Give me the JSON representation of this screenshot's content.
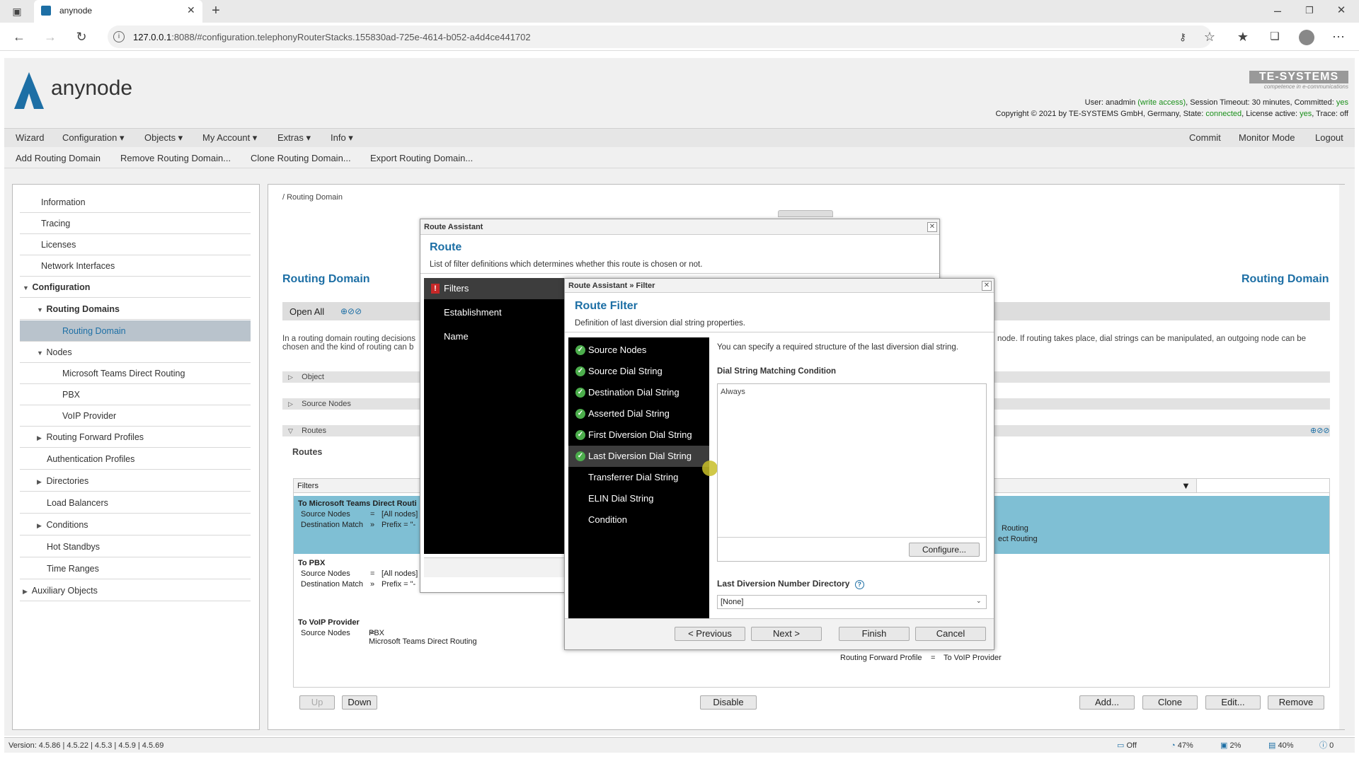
{
  "browser": {
    "tab_title": "anynode",
    "url_host": "127.0.0.1",
    "url_rest": ":8088/#configuration.telephonyRouterStacks.155830ad-725e-4614-b052-a4d4ce441702"
  },
  "header": {
    "logo_text": "anynode",
    "brand": "TE-SYSTEMS",
    "brand_tagline": "competence in e-communications",
    "status_line1_pre": "User: anadmin ",
    "status_line1_access": "(write access)",
    "status_line1_mid": ", Session Timeout: 30 minutes, Committed: ",
    "status_line1_committed": "yes",
    "status_line2_pre": "Copyright © 2021 by TE-SYSTEMS GmbH, Germany, State: ",
    "status_line2_state": "connected",
    "status_line2_mid": ", License active: ",
    "status_line2_license": "yes",
    "status_line2_trace": ", Trace: off"
  },
  "menubar": {
    "items": [
      "Wizard",
      "Configuration ▾",
      "Objects ▾",
      "My Account ▾",
      "Extras ▾",
      "Info ▾"
    ],
    "right": [
      "Commit",
      "Monitor Mode",
      "Logout"
    ]
  },
  "toolbar": [
    "Add Routing Domain",
    "Remove Routing Domain...",
    "Clone Routing Domain...",
    "Export Routing Domain..."
  ],
  "sidebar": [
    "Information",
    "Tracing",
    "Licenses",
    "Network Interfaces",
    "Configuration",
    "Routing Domains",
    "Routing Domain",
    "Nodes",
    "Microsoft Teams Direct Routing",
    "PBX",
    "VoIP Provider",
    "Routing Forward Profiles",
    "Authentication Profiles",
    "Directories",
    "Load Balancers",
    "Conditions",
    "Hot Standbys",
    "Time Ranges",
    "Auxiliary Objects"
  ],
  "main": {
    "breadcrumb": "/ Routing Domain",
    "title": "Routing Domain",
    "title_right": "Routing Domain",
    "open_all": "Open All",
    "desc_left1": "In a routing domain routing decisions",
    "desc_left2": "chosen and the kind of routing can b",
    "desc_right1": "node. If routing takes place, dial strings can be manipulated, an outgoing node can be",
    "section_object": "Object",
    "section_source": "Source Nodes",
    "section_routes": "Routes",
    "routes_label": "Routes",
    "col_filters": "Filters",
    "route1": {
      "name": "To Microsoft Teams Direct Routi",
      "k1": "Source Nodes",
      "op1": "=",
      "v1": "[All nodes]",
      "k2": "Destination Match",
      "op2": "»",
      "v2": "Prefix = \"-",
      "r1": "Routing",
      "r2": "ect Routing"
    },
    "route2": {
      "name": "To PBX",
      "k1": "Source Nodes",
      "op1": "=",
      "v1": "[All nodes]",
      "k2": "Destination Match",
      "op2": "»",
      "v2": "Prefix = \"-"
    },
    "route3": {
      "name": "To VoIP Provider",
      "k1": "Source Nodes",
      "op1": "=",
      "v1": "PBX",
      "v1b": "Microsoft Teams Direct Routing",
      "fwd_key": "Routing Forward Profile",
      "fwd_op": "=",
      "fwd_val": "To VoIP Provider"
    },
    "buttons": {
      "up": "Up",
      "down": "Down",
      "disable": "Disable",
      "add": "Add...",
      "clone": "Clone",
      "edit": "Edit...",
      "remove": "Remove"
    }
  },
  "dialog1": {
    "header": "Route Assistant",
    "title": "Route",
    "desc": "List of filter definitions which determines whether this route is chosen or not.",
    "nav": [
      "Filters",
      "Establishment",
      "Name"
    ]
  },
  "dialog2": {
    "header": "Route Assistant » Filter",
    "title": "Route Filter",
    "desc": "Definition of last diversion dial string properties.",
    "nav": [
      {
        "label": "Source Nodes",
        "done": true
      },
      {
        "label": "Source Dial String",
        "done": true
      },
      {
        "label": "Destination Dial String",
        "done": true
      },
      {
        "label": "Asserted Dial String",
        "done": true
      },
      {
        "label": "First Diversion Dial String",
        "done": true
      },
      {
        "label": "Last Diversion Dial String",
        "done": true
      },
      {
        "label": "Transferrer Dial String",
        "done": false
      },
      {
        "label": "ELIN Dial String",
        "done": false
      },
      {
        "label": "Condition",
        "done": false
      }
    ],
    "intro": "You can specify a required structure of the last diversion dial string.",
    "matching_label": "Dial String Matching Condition",
    "matching_value": "Always",
    "configure": "Configure...",
    "directory_label": "Last Diversion Number Directory",
    "directory_value": "[None]",
    "buttons": {
      "previous": "< Previous",
      "next": "Next >",
      "finish": "Finish",
      "cancel": "Cancel"
    }
  },
  "statusbar": {
    "version": "Version: 4.5.86 | 4.5.22 | 4.5.3 | 4.5.9 | 4.5.69",
    "off": "Off",
    "cpu": "47%",
    "disk": "2%",
    "mem": "40%",
    "alerts": "0"
  },
  "colors": {
    "accent": "#1d6fa5",
    "selection": "#7fbfd4",
    "nav_bg": "#000000",
    "ok": "#4cae4c"
  }
}
